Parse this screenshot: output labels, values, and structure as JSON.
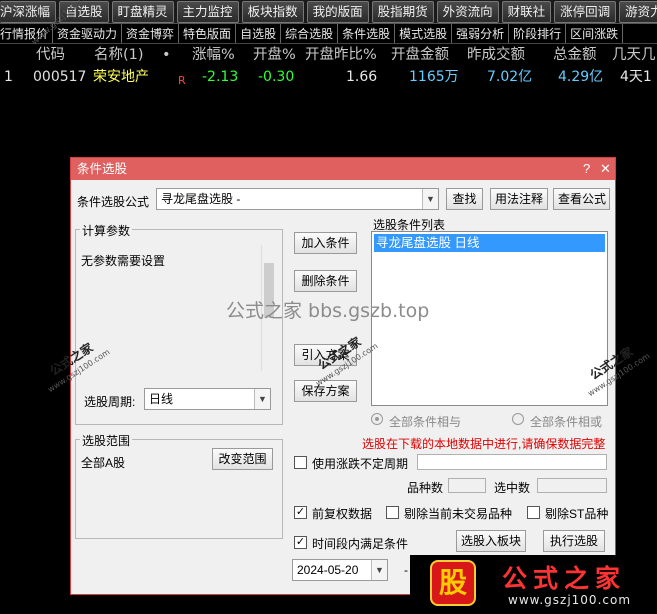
{
  "toolbar": {
    "tabs": [
      "沪深涨幅",
      "自选股",
      "盯盘精灵",
      "主力监控",
      "板块指数",
      "我的版面",
      "股指期货",
      "外资流向",
      "财联社",
      "涨停回调",
      "游资力"
    ]
  },
  "subtabs": [
    "行情报价",
    "资金驱动力",
    "资金博弈",
    "特色版面",
    "自选股",
    "综合选股",
    "条件选股",
    "模式选股",
    "强弱分析",
    "阶段排行",
    "区间涨跌"
  ],
  "quote_table": {
    "headers": [
      "代码",
      "名称(1)",
      "•",
      "涨幅%",
      "开盘%",
      "开盘昨比%",
      "开盘金额",
      "昨成交额",
      "总金额",
      "几天几"
    ],
    "row": {
      "index": "1",
      "code": "000517",
      "name": "荣安地产",
      "flag": "R",
      "change_pct": "-2.13",
      "open_pct": "-0.30",
      "open_ratio": "1.66",
      "open_amount": "1165万",
      "prev_volume": "7.02亿",
      "total_amount": "4.29亿",
      "days": "4天1"
    }
  },
  "dialog": {
    "title": "条件选股",
    "help_icon": "?",
    "close_icon": "✕",
    "formula_label": "条件选股公式",
    "formula_value": "寻龙尾盘选股  -",
    "find_button": "查找",
    "usage_button": "用法注释",
    "view_formula_button": "查看公式",
    "params_title": "计算参数",
    "params_text": "无参数需要设置",
    "add_condition_button": "加入条件",
    "delete_condition_button": "删除条件",
    "import_plan_button": "引入方案",
    "save_plan_button": "保存方案",
    "condition_list_title": "选股条件列表",
    "condition_list_items": [
      "寻龙尾盘选股  日线"
    ],
    "period_label": "选股周期:",
    "period_value": "日线",
    "radio_and": "全部条件相与",
    "radio_or": "全部条件相或",
    "warning_text": "选股在下载的本地数据中进行,请确保数据完整",
    "range_title": "选股范围",
    "range_value": "全部A股",
    "change_range_button": "改变范围",
    "use_limit_period": "使用涨跌不定周期",
    "variety_count_label": "品种数",
    "selected_count_label": "选中数",
    "forward_adjust": "前复权数据",
    "exclude_untraded": "剔除当前未交易品种",
    "exclude_st": "剔除ST品种",
    "time_range_label": "时间段内满足条件",
    "select_to_block_button": "选股入板块",
    "execute_button": "执行选股",
    "date_value": "2024-05-20",
    "date_sep": "-"
  },
  "checkboxes": {
    "use_limit_period": false,
    "forward_adjust": true,
    "exclude_untraded": false,
    "exclude_st": false,
    "time_range": true
  },
  "radios": {
    "and_selected": true
  },
  "watermarks": {
    "center": "公式之家 bbs.gszb.top",
    "stamp": "公式之家",
    "stamp_url": "www.gszj100.com",
    "diag": "www.gszj100.com"
  },
  "brand": {
    "logo_char": "股",
    "text": "公式之家",
    "url": "www.gszj100.com"
  },
  "colors": {
    "title_bar": "#e06060",
    "selection": "#3399ff",
    "warning": "#e00000",
    "quote_down": "#33ff33",
    "quote_name": "#ffff55"
  }
}
